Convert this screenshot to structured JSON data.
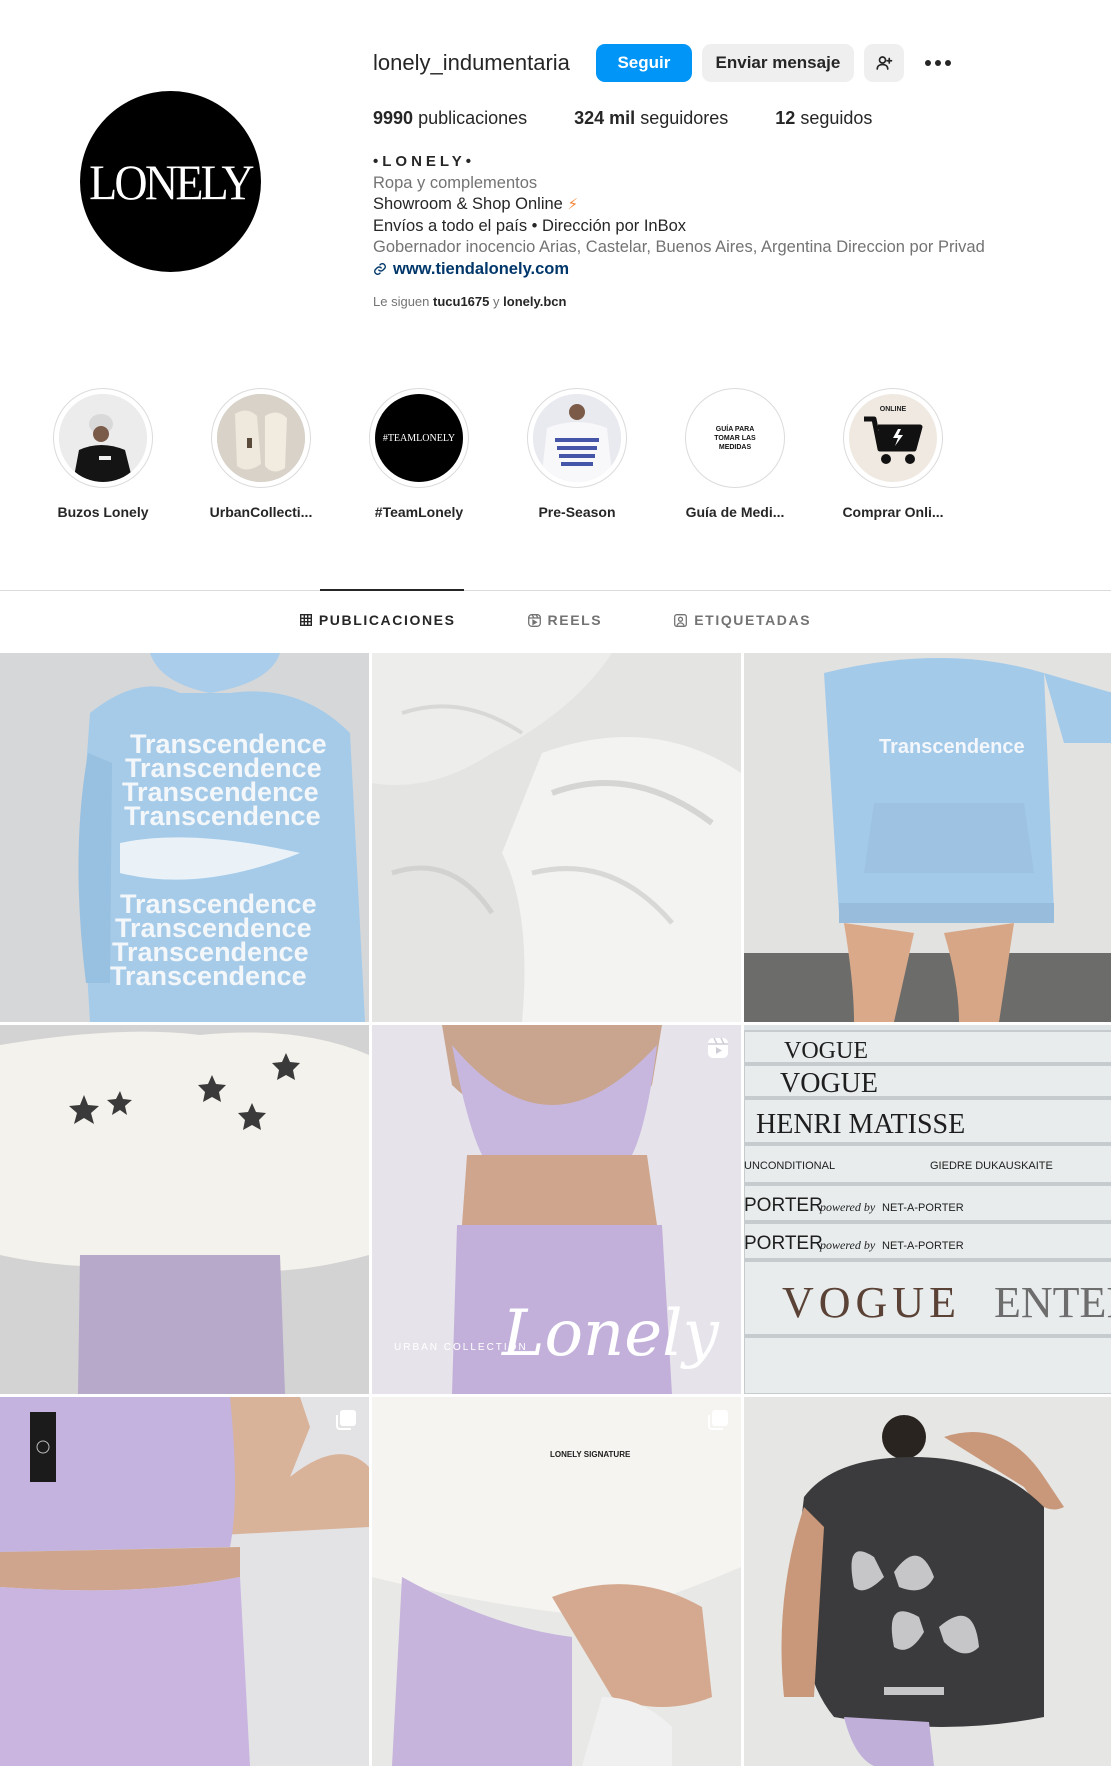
{
  "profile": {
    "username": "lonely_indumentaria",
    "avatar_text": "LONELY",
    "follow_label": "Seguir",
    "message_label": "Enviar mensaje",
    "stats": {
      "posts_count": "9990",
      "posts_label": "publicaciones",
      "followers_count": "324 mil",
      "followers_label": "seguidores",
      "following_count": "12",
      "following_label": "seguidos"
    },
    "bio": {
      "name": "•LONELY•",
      "category": "Ropa y complementos",
      "line1": "Showroom & Shop Online",
      "line2": "Envíos a todo el país • Dirección por InBox",
      "address": "Gobernador inocencio Arias, Castelar, Buenos Aires, Argentina Direccion por Privad",
      "link": "www.tiendalonely.com"
    },
    "followed_by": {
      "prefix": "Le siguen",
      "user1": "tucu1675",
      "conj": "y",
      "user2": "lonely.bcn"
    }
  },
  "highlights": [
    {
      "label": "Buzos Lonely"
    },
    {
      "label": "UrbanCollecti..."
    },
    {
      "label": "#TeamLonely",
      "cover_text": "#TEAMLONELY"
    },
    {
      "label": "Pre-Season"
    },
    {
      "label": "Guía de Medi...",
      "cover_text": "GUÍA PARA TOMAR LAS MEDIDAS"
    },
    {
      "label": "Comprar Onli...",
      "cover_text": "ONLINE"
    }
  ],
  "tabs": [
    {
      "label": "PUBLICACIONES",
      "active": true
    },
    {
      "label": "REELS",
      "active": false
    },
    {
      "label": "ETIQUETADAS",
      "active": false
    }
  ],
  "posts": [
    {
      "type": "image",
      "print_text": "Transcendence"
    },
    {
      "type": "image"
    },
    {
      "type": "image",
      "print_text": "Transcendence"
    },
    {
      "type": "image"
    },
    {
      "type": "reel",
      "overlay_text": "Lonely",
      "overlay_sub": "URBAN COLLECTION"
    },
    {
      "type": "image",
      "spines": [
        "VOGUE",
        "VOGUE",
        "HENRI MATISSE",
        "UNCONDITIONAL",
        "GIEDRE DUKAUSKAITE",
        "PORTER",
        "powered by",
        "NET-A-PORTER",
        "PORTER",
        "powered by",
        "NET-A-PORTER",
        "VOGUE",
        "ENTER"
      ]
    },
    {
      "type": "carousel"
    },
    {
      "type": "carousel",
      "print_text": "LONELY SIGNATURE"
    },
    {
      "type": "image"
    }
  ],
  "colors": {
    "accent": "#0095f6",
    "secondary_button": "#efefef",
    "link": "#00376b",
    "muted": "#737373",
    "border": "#dbdbdb"
  }
}
